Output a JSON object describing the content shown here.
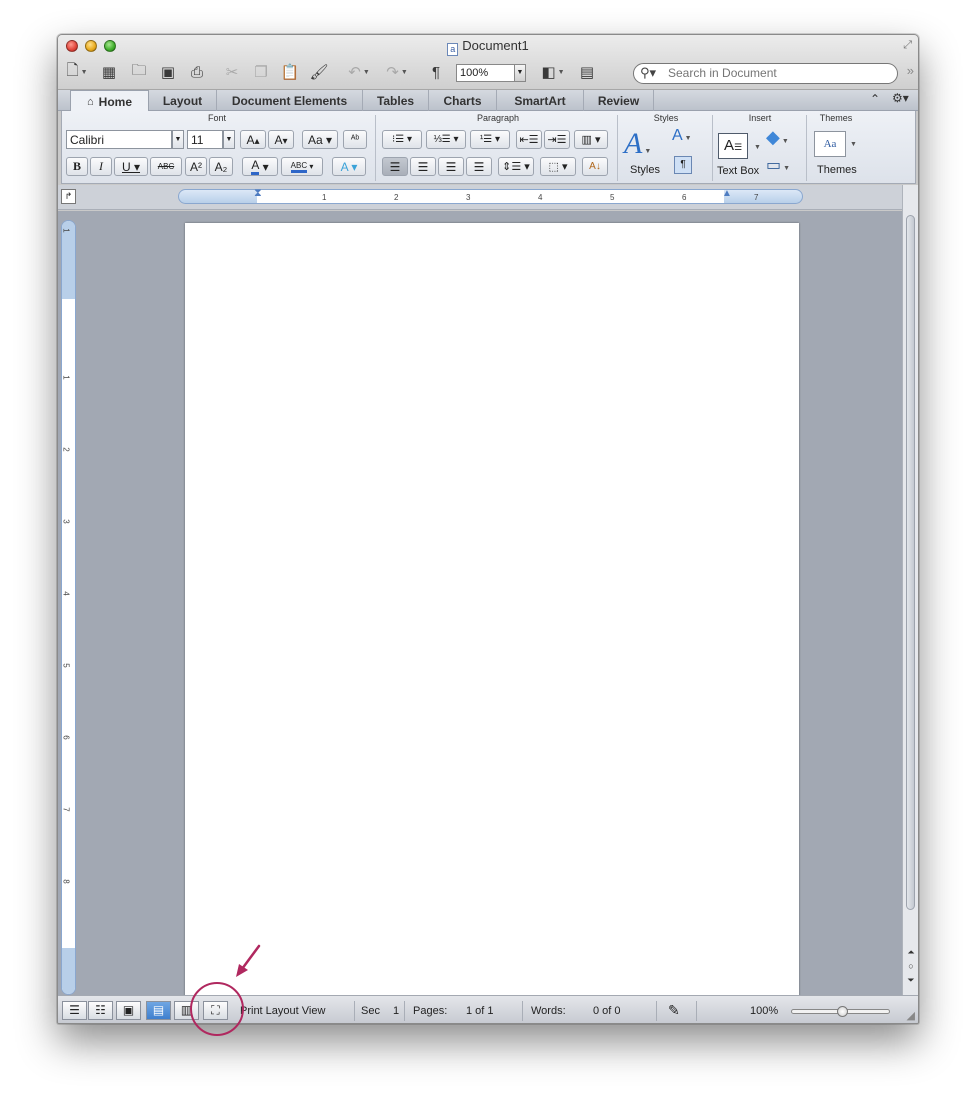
{
  "window": {
    "title": "Document1"
  },
  "toolbar": {
    "zoom_value": "100%",
    "search_placeholder": "Search in Document"
  },
  "ribbon": {
    "tabs": [
      {
        "label": "Home",
        "active": true
      },
      {
        "label": "Layout"
      },
      {
        "label": "Document Elements"
      },
      {
        "label": "Tables"
      },
      {
        "label": "Charts"
      },
      {
        "label": "SmartArt"
      },
      {
        "label": "Review"
      }
    ],
    "groups": {
      "font": "Font",
      "paragraph": "Paragraph",
      "styles": "Styles",
      "insert": "Insert",
      "themes": "Themes"
    },
    "font_name": "Calibri",
    "font_size": "11",
    "styles_label": "Styles",
    "textbox_label": "Text Box",
    "themes_label": "Themes"
  },
  "ruler": {
    "h_ticks": [
      "1",
      "2",
      "3",
      "4",
      "5",
      "6",
      "7"
    ],
    "v_ticks": [
      "1",
      "1",
      "2",
      "3",
      "4",
      "5",
      "6",
      "7",
      "8"
    ]
  },
  "statusbar": {
    "view_name": "Print Layout View",
    "sec_label": "Sec",
    "sec_value": "1",
    "pages_label": "Pages:",
    "pages_value": "1 of 1",
    "words_label": "Words:",
    "words_value": "0 of 0",
    "zoom": "100%"
  },
  "colors": {
    "annotation": "#b0285f",
    "active_view": "#3f7fce"
  }
}
